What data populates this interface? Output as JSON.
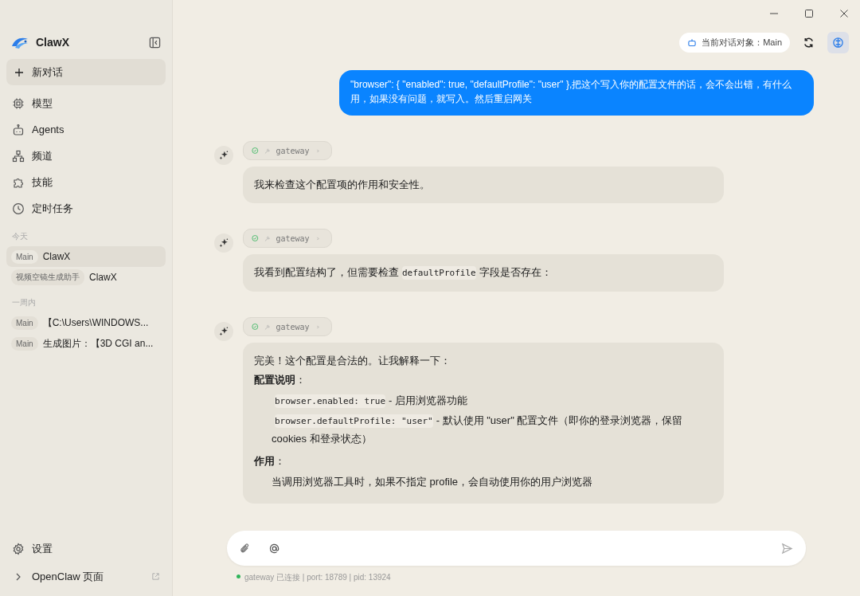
{
  "sidebar": {
    "app_name": "ClawX",
    "new_chat": "新对话",
    "nav": [
      {
        "label": "模型"
      },
      {
        "label": "Agents"
      },
      {
        "label": "频道"
      },
      {
        "label": "技能"
      },
      {
        "label": "定时任务"
      }
    ],
    "groups": [
      {
        "heading": "今天",
        "sessions": [
          {
            "tag": "Main",
            "title": "ClawX",
            "selected": true
          },
          {
            "tag": "视频空镜生成助手",
            "title": "ClawX",
            "selected": false
          }
        ]
      },
      {
        "heading": "一周内",
        "sessions": [
          {
            "tag": "Main",
            "title": "【C:\\Users\\WINDOWS...",
            "selected": false
          },
          {
            "tag": "Main",
            "title": "生成图片：【3D CGI an...",
            "selected": false
          }
        ]
      }
    ],
    "settings": "设置",
    "external_link": "OpenClaw 页面"
  },
  "header": {
    "target_label": "当前对话对象：Main"
  },
  "messages": [
    {
      "kind": "user",
      "text": "\"browser\": { \"enabled\": true, \"defaultProfile\": \"user\" },把这个写入你的配置文件的话，会不会出错，有什么用，如果没有问题，就写入。然后重启网关"
    },
    {
      "kind": "assistant",
      "tool": {
        "name": "gateway",
        "succeeded": true
      },
      "blocks": [
        {
          "kind": "p",
          "parts": [
            {
              "kind": "text",
              "text": "我来检查这个配置项的作用和安全性。"
            }
          ]
        }
      ]
    },
    {
      "kind": "assistant",
      "tool": {
        "name": "gateway",
        "succeeded": true
      },
      "blocks": [
        {
          "kind": "p",
          "parts": [
            {
              "kind": "text",
              "text": "我看到配置结构了，但需要检查"
            },
            {
              "kind": "code",
              "text": "defaultProfile"
            },
            {
              "kind": "text",
              "text": "字段是否存在："
            }
          ]
        }
      ]
    },
    {
      "kind": "assistant",
      "tool": {
        "name": "gateway",
        "succeeded": true
      },
      "blocks": [
        {
          "kind": "p",
          "parts": [
            {
              "kind": "text",
              "text": "完美！这个配置是合法的。让我解释一下："
            }
          ]
        },
        {
          "kind": "h",
          "text": "配置说明",
          "suffix": "："
        },
        {
          "kind": "ul",
          "items": [
            [
              {
                "kind": "code",
                "text": "browser.enabled: true"
              },
              {
                "kind": "text",
                "text": "- 启用浏览器功能"
              }
            ],
            [
              {
                "kind": "code",
                "text": "browser.defaultProfile: \"user\""
              },
              {
                "kind": "text",
                "text": "- 默认使用 \"user\" 配置文件（即你的登录浏览器，保留 cookies 和登录状态）"
              }
            ]
          ]
        },
        {
          "kind": "h",
          "text": "作用",
          "suffix": "："
        },
        {
          "kind": "ul",
          "items": [
            [
              {
                "kind": "text",
                "text": "当调用浏览器工具时，如果不指定 profile，会自动使用你的用户浏览器"
              }
            ]
          ]
        }
      ]
    }
  ],
  "status": {
    "connected": true,
    "text": "gateway 已连接 | port: 18789 | pid: 13924"
  }
}
